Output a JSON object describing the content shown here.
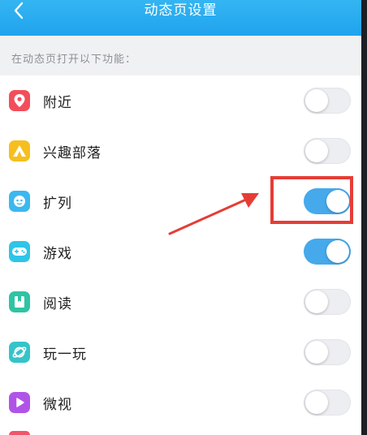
{
  "header": {
    "title": "动态页设置",
    "back_icon": "chevron-left-icon",
    "color": "#27aaef"
  },
  "section": {
    "caption": "在动态页打开以下功能："
  },
  "items": [
    {
      "label": "附近",
      "icon": "location-pin-icon",
      "icon_color": "#f24e5a",
      "enabled": false
    },
    {
      "label": "兴趣部落",
      "icon": "tent-icon",
      "icon_color": "#f6bf1e",
      "enabled": false
    },
    {
      "label": "扩列",
      "icon": "chat-bubble-icon",
      "icon_color": "#3bb8f0",
      "enabled": true
    },
    {
      "label": "游戏",
      "icon": "gamepad-icon",
      "icon_color": "#2ec5e8",
      "enabled": true
    },
    {
      "label": "阅读",
      "icon": "book-icon",
      "icon_color": "#2ec4a4",
      "enabled": false
    },
    {
      "label": "玩一玩",
      "icon": "planet-icon",
      "icon_color": "#35c4c8",
      "enabled": false
    },
    {
      "label": "微视",
      "icon": "play-icon",
      "icon_color": "#b054e8",
      "enabled": false
    }
  ],
  "toggle_on_color": "#45a9ec",
  "annotation_color": "#e53d36"
}
